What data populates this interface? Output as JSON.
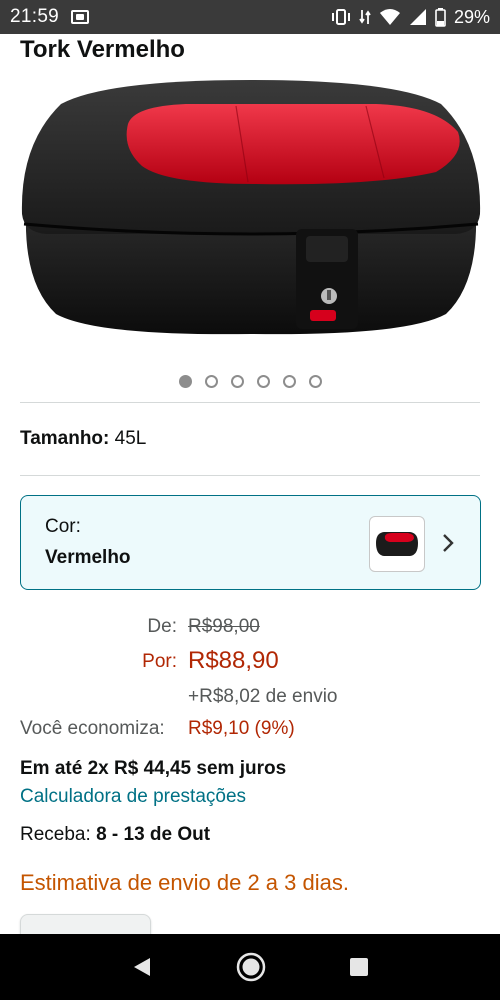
{
  "status_bar": {
    "time": "21:59",
    "battery_percent": "29%",
    "icons": [
      "screenshot-icon",
      "vibrate-icon",
      "data-icon",
      "wifi-icon",
      "signal-icon",
      "battery-icon"
    ]
  },
  "product": {
    "title": "Tork Vermelho",
    "image_icon": "motorcycle-top-case-image",
    "carousel": {
      "count": 6,
      "active_index": 0
    }
  },
  "size": {
    "label": "Tamanho:",
    "value": "45L"
  },
  "color": {
    "label": "Cor:",
    "value": "Vermelho",
    "thumb_icon": "top-case-thumbnail",
    "chevron_icon": "chevron-right-icon"
  },
  "price": {
    "list_label": "De:",
    "list_value": "R$98,00",
    "sale_label": "Por:",
    "sale_value": "R$88,90",
    "shipping": "+R$8,02 de envio",
    "savings_label": "Você economiza:",
    "savings_value": "R$9,10 (9%)"
  },
  "installments": "Em até 2x R$ 44,45 sem juros",
  "calculator_link": "Calculadora de prestações",
  "delivery": {
    "label": "Receba:",
    "value": "8 - 13 de Out"
  },
  "estimate": "Estimativa de envio de 2 a 3 dias.",
  "nav": {
    "icons": [
      "back-icon",
      "home-icon",
      "recents-icon"
    ]
  },
  "colors": {
    "accent_link": "#007185",
    "price_red": "#b12704",
    "estimate_orange": "#c45500",
    "selector_bg": "#edfafc",
    "status_bar_bg": "#3a3a3a",
    "nav_bar_bg": "#000000"
  }
}
